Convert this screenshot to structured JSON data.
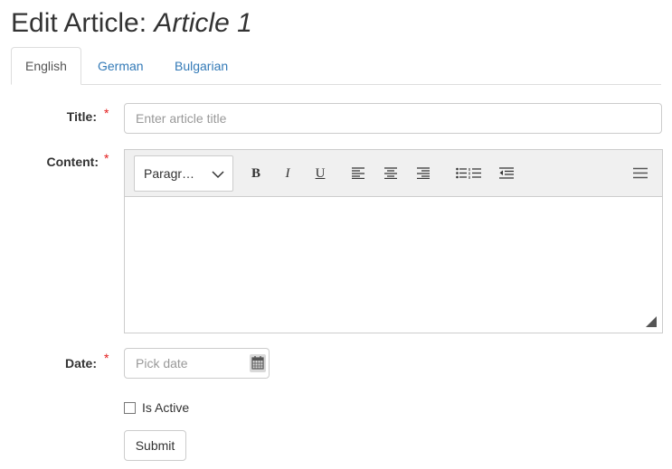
{
  "page": {
    "title_prefix": "Edit Article:",
    "title_name": "Article 1"
  },
  "tabs": [
    {
      "label": "English",
      "active": true
    },
    {
      "label": "German",
      "active": false
    },
    {
      "label": "Bulgarian",
      "active": false
    }
  ],
  "form": {
    "required_marker": "*",
    "title": {
      "label": "Title:",
      "placeholder": "Enter article title",
      "value": ""
    },
    "content": {
      "label": "Content:",
      "value": ""
    },
    "date": {
      "label": "Date:",
      "placeholder": "Pick date",
      "value": ""
    },
    "is_active": {
      "label": "Is Active",
      "checked": false
    },
    "submit_label": "Submit"
  },
  "editor": {
    "format_value": "Paragr…",
    "buttons": [
      "bold-icon",
      "italic-icon",
      "underline-icon",
      "align-left-icon",
      "align-center-icon",
      "align-right-icon",
      "list-icon",
      "outdent-icon",
      "menu-icon"
    ],
    "bold_glyph": "B",
    "italic_glyph": "I",
    "underline_glyph": "U"
  },
  "colors": {
    "link": "#337ab7",
    "required": "#e31b1b",
    "toolbar_bg": "#f0f0f0",
    "border": "#cccccc"
  }
}
